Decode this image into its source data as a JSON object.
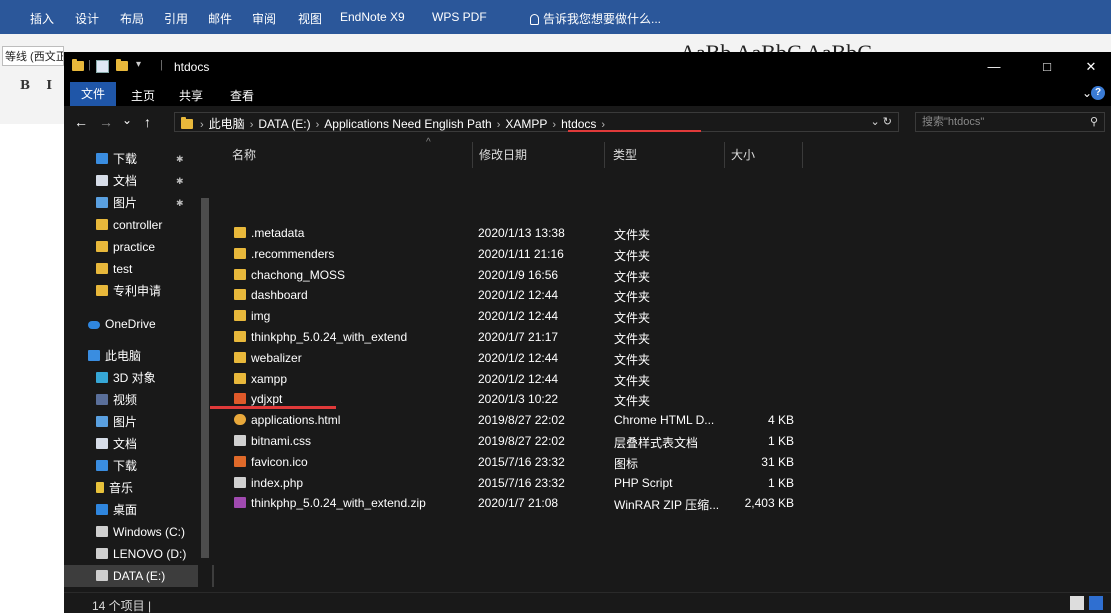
{
  "word": {
    "tabs": [
      "插入",
      "设计",
      "布局",
      "引用",
      "邮件",
      "审阅",
      "视图",
      "EndNote X9",
      "WPS PDF"
    ],
    "tell_me": "告诉我您想要做什么...",
    "font_name": "等线 (西文正",
    "bold_italic": "B I",
    "style_preview": "AaBb AaBbC AaBbC"
  },
  "explorer": {
    "window_title": "htdocs",
    "ribbon_tabs": {
      "file": "文件",
      "home": "主页",
      "share": "共享",
      "view": "查看"
    },
    "window_controls": {
      "minimize": "—",
      "maximize": "□",
      "close": "✕"
    },
    "nav_buttons": {
      "back": "←",
      "forward": "→",
      "recent": "⌄",
      "up": "↑"
    },
    "breadcrumb": [
      "此电脑",
      "DATA (E:)",
      "Applications Need English Path",
      "XAMPP",
      "htdocs"
    ],
    "search_placeholder": "搜索\"htdocs\"",
    "columns": {
      "name": "名称",
      "date": "修改日期",
      "type": "类型",
      "size": "大小"
    },
    "nav_items": [
      {
        "label": "下载",
        "icon": "download-icon",
        "pinned": true
      },
      {
        "label": "文档",
        "icon": "document-icon",
        "pinned": true
      },
      {
        "label": "图片",
        "icon": "picture-icon",
        "pinned": true
      },
      {
        "label": "controller",
        "icon": "folder-icon"
      },
      {
        "label": "practice",
        "icon": "folder-icon"
      },
      {
        "label": "test",
        "icon": "folder-icon"
      },
      {
        "label": "专利申请",
        "icon": "folder-icon"
      },
      {
        "label": "OneDrive",
        "icon": "cloud-icon"
      },
      {
        "label": "此电脑",
        "icon": "computer-icon"
      },
      {
        "label": "3D 对象",
        "icon": "3d-objects-icon"
      },
      {
        "label": "视频",
        "icon": "video-icon"
      },
      {
        "label": "图片",
        "icon": "picture-icon"
      },
      {
        "label": "文档",
        "icon": "document-icon"
      },
      {
        "label": "下载",
        "icon": "download-icon"
      },
      {
        "label": "音乐",
        "icon": "music-icon"
      },
      {
        "label": "桌面",
        "icon": "desktop-icon"
      },
      {
        "label": "Windows (C:)",
        "icon": "drive-icon"
      },
      {
        "label": "LENOVO (D:)",
        "icon": "drive-icon"
      },
      {
        "label": "DATA (E:)",
        "icon": "drive-icon",
        "selected": true
      }
    ],
    "files": [
      {
        "name": ".metadata",
        "date": "2020/1/13 13:38",
        "type": "文件夹",
        "size": "",
        "icon": "folder-icon"
      },
      {
        "name": ".recommenders",
        "date": "2020/1/11 21:16",
        "type": "文件夹",
        "size": "",
        "icon": "folder-icon"
      },
      {
        "name": "chachong_MOSS",
        "date": "2020/1/9 16:56",
        "type": "文件夹",
        "size": "",
        "icon": "folder-icon"
      },
      {
        "name": "dashboard",
        "date": "2020/1/2 12:44",
        "type": "文件夹",
        "size": "",
        "icon": "folder-icon"
      },
      {
        "name": "img",
        "date": "2020/1/2 12:44",
        "type": "文件夹",
        "size": "",
        "icon": "folder-icon"
      },
      {
        "name": "thinkphp_5.0.24_with_extend",
        "date": "2020/1/7 21:17",
        "type": "文件夹",
        "size": "",
        "icon": "folder-icon"
      },
      {
        "name": "webalizer",
        "date": "2020/1/2 12:44",
        "type": "文件夹",
        "size": "",
        "icon": "folder-icon"
      },
      {
        "name": "xampp",
        "date": "2020/1/2 12:44",
        "type": "文件夹",
        "size": "",
        "icon": "folder-icon"
      },
      {
        "name": "ydjxpt",
        "date": "2020/1/3 10:22",
        "type": "文件夹",
        "size": "",
        "icon": "red-folder-icon"
      },
      {
        "name": "applications.html",
        "date": "2019/8/27 22:02",
        "type": "Chrome HTML D...",
        "size": "4 KB",
        "icon": "chrome-icon"
      },
      {
        "name": "bitnami.css",
        "date": "2019/8/27 22:02",
        "type": "层叠样式表文档",
        "size": "1 KB",
        "icon": "css-file-icon"
      },
      {
        "name": "favicon.ico",
        "date": "2015/7/16 23:32",
        "type": "图标",
        "size": "31 KB",
        "icon": "ico-file-icon"
      },
      {
        "name": "index.php",
        "date": "2015/7/16 23:32",
        "type": "PHP Script",
        "size": "1 KB",
        "icon": "php-file-icon"
      },
      {
        "name": "thinkphp_5.0.24_with_extend.zip",
        "date": "2020/1/7 21:08",
        "type": "WinRAR ZIP 压缩...",
        "size": "2,403 KB",
        "icon": "zip-archive-icon"
      }
    ],
    "status": "14 个项目  |"
  }
}
